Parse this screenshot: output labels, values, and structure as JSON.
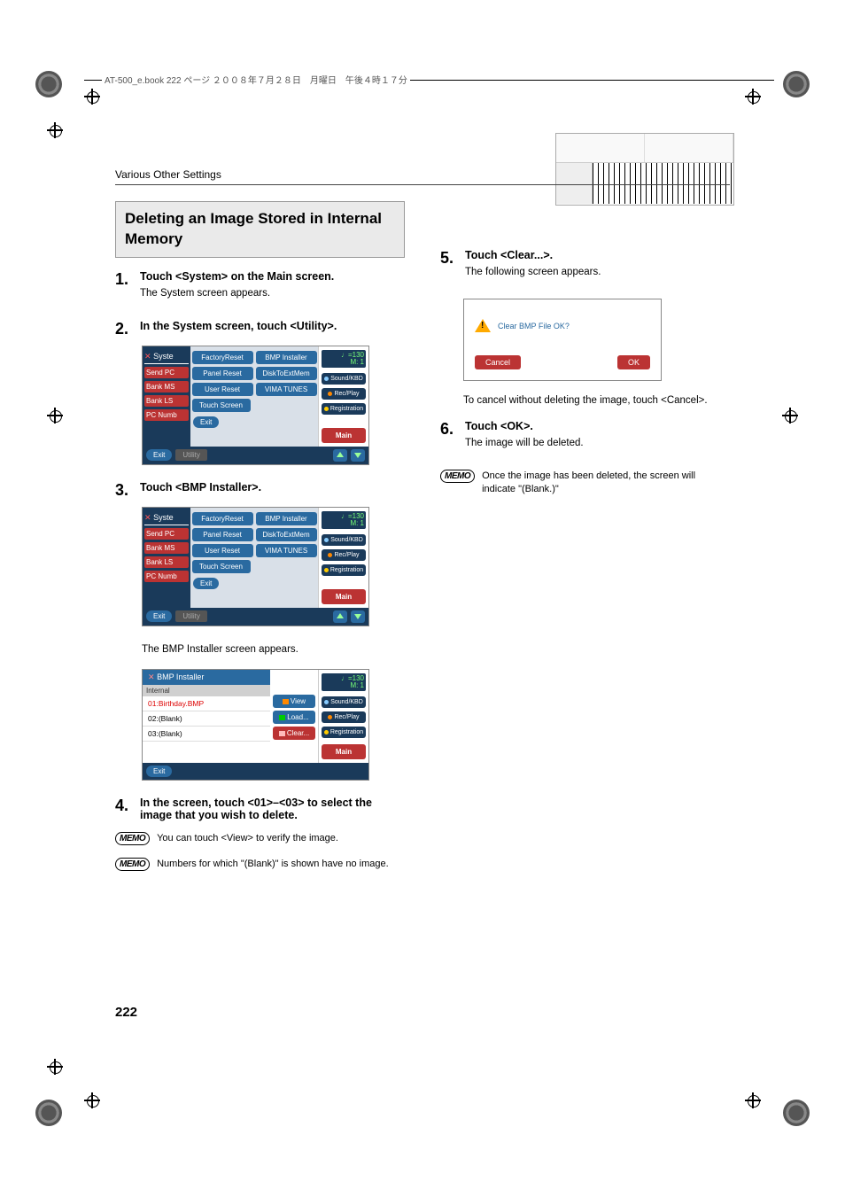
{
  "book_stamp": "AT-500_e.book 222 ページ ２００８年７月２８日　月曜日　午後４時１７分",
  "breadcrumb": "Various Other Settings",
  "page_number": "222",
  "section_title": "Deleting an Image Stored in Internal Memory",
  "steps": {
    "s1": {
      "num": "1.",
      "title": "Touch <System> on the Main screen.",
      "text": "The System screen appears."
    },
    "s2": {
      "num": "2.",
      "title": "In the System screen, touch <Utility>."
    },
    "s3": {
      "num": "3.",
      "title": "Touch <BMP Installer>.",
      "after": "The BMP Installer screen appears."
    },
    "s4": {
      "num": "4.",
      "title": "In the screen, touch <01>–<03> to select the image that you wish to delete."
    },
    "s5": {
      "num": "5.",
      "title": "Touch <Clear...>.",
      "text": "The following screen appears.",
      "after": "To cancel without deleting the image, touch <Cancel>."
    },
    "s6": {
      "num": "6.",
      "title": "Touch <OK>.",
      "text": "The image will be deleted."
    }
  },
  "memos": {
    "m1": {
      "label": "MEMO",
      "text": "You can touch <View> to verify the image."
    },
    "m2": {
      "label": "MEMO",
      "text": "Numbers for which \"(Blank)\" is shown have no image."
    },
    "m3": {
      "label": "MEMO",
      "text": "Once the image has been deleted, the screen will indicate \"(Blank.)\""
    }
  },
  "device": {
    "tempo": "♩=130",
    "measure": "M:   1",
    "left_title": "Syste",
    "left_tabs": [
      "Send PC",
      "Bank MS",
      "Bank LS",
      "PC Numb"
    ],
    "buttons_util": {
      "r1a": "FactoryReset",
      "r1b": "BMP Installer",
      "r2a": "Panel Reset",
      "r2b": "DiskToExtMem",
      "r3a": "User Reset",
      "r3b": "VIMA TUNES",
      "r4a": "Touch Screen"
    },
    "exit": "Exit",
    "utility": "Utility",
    "side": {
      "a": "Sound/KBD",
      "b": "Rec/Play",
      "c": "Registration",
      "main": "Main"
    }
  },
  "bmp": {
    "title": "BMP Installer",
    "sub": "Internal",
    "items": [
      "01:Birthday.BMP",
      "02:(Blank)",
      "03:(Blank)"
    ],
    "actions": {
      "view": "View",
      "load": "Load...",
      "clear": "Clear..."
    }
  },
  "confirm": {
    "msg": "Clear BMP File OK?",
    "cancel": "Cancel",
    "ok": "OK"
  }
}
